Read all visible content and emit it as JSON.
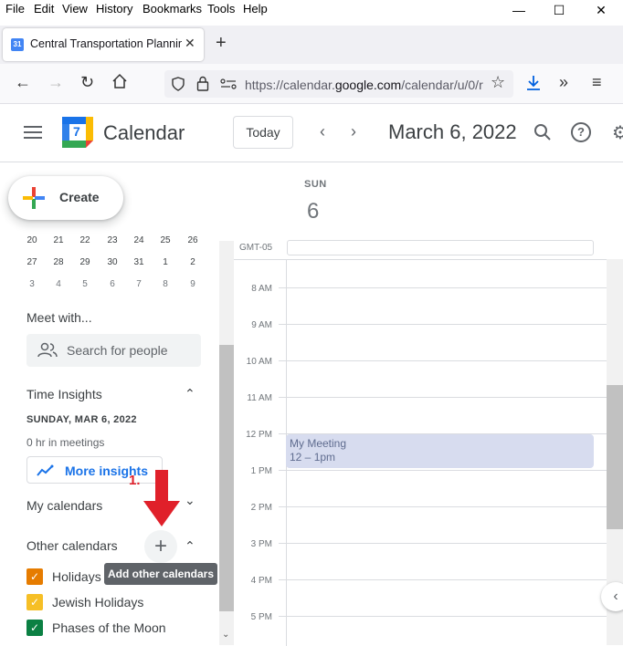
{
  "browser": {
    "menu": [
      "File",
      "Edit",
      "View",
      "History",
      "Bookmarks",
      "Tools",
      "Help"
    ],
    "tab": {
      "favicon_text": "31",
      "title": "Central Transportation Planning"
    },
    "url": {
      "prefix": "https://calendar.",
      "domain": "google.com",
      "suffix": "/calendar/u/0/r"
    }
  },
  "header": {
    "app_title": "Calendar",
    "logo_text": "7",
    "today_label": "Today",
    "date_title": "March 6, 2022"
  },
  "sidebar": {
    "create_label": "Create",
    "mini_calendar": [
      [
        "20",
        "21",
        "22",
        "23",
        "24",
        "25",
        "26"
      ],
      [
        "27",
        "28",
        "29",
        "30",
        "31",
        "1",
        "2"
      ],
      [
        "3",
        "4",
        "5",
        "6",
        "7",
        "8",
        "9"
      ]
    ],
    "meet_with": "Meet with...",
    "people_search_placeholder": "Search for people",
    "time_insights": "Time Insights",
    "insights_date": "SUNDAY, MAR 6, 2022",
    "insights_meetings": "0 hr in meetings",
    "more_insights": "More insights",
    "my_calendars": "My calendars",
    "other_calendars": "Other calendars",
    "other_calendar_items": [
      {
        "label": "Holidays",
        "color": "#e67c00"
      },
      {
        "label": "Jewish Holidays",
        "color": "#f6bf26"
      },
      {
        "label": "Phases of the Moon",
        "color": "#0b8043"
      }
    ],
    "tooltip": "Add other calendars",
    "step_label": "1."
  },
  "main": {
    "day_name": "SUN",
    "day_number": "6",
    "timezone": "GMT-05",
    "hours": [
      "8 AM",
      "9 AM",
      "10 AM",
      "11 AM",
      "12 PM",
      "1 PM",
      "2 PM",
      "3 PM",
      "4 PM",
      "5 PM"
    ],
    "event": {
      "title": "My Meeting",
      "time": "12 – 1pm"
    }
  },
  "colors": {
    "accent": "#1a73e8",
    "event_bg": "#d7dcef",
    "annotation": "#e0202a"
  }
}
